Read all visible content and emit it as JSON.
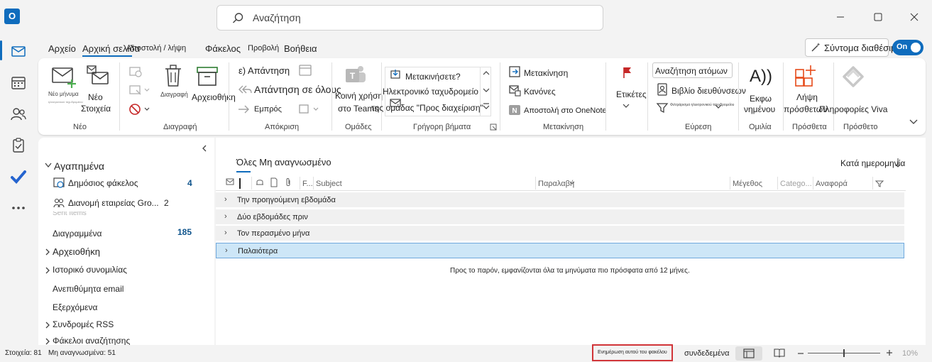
{
  "titlebar": {
    "app_icon_text": "O",
    "search_placeholder": "Αναζήτηση"
  },
  "tabs": [
    {
      "label": "Αρχείο"
    },
    {
      "label": "Αρχική σελίδα"
    },
    {
      "label": "Αποστολή / λήψη"
    },
    {
      "label": "Φάκελος"
    },
    {
      "label": "Προβολή"
    },
    {
      "label": "Βοήθεια"
    }
  ],
  "simplified_ribbon_label": "Σύντομα διαθέσιμο",
  "toggle_label": "On",
  "ribbon": {
    "new_email_label": "Νέο μήνυμα",
    "new_email_sub": "ηλεκτρονικού ταχυδρομείου",
    "new_items_line1": "Νέο",
    "new_items_line2": "Στοιχεία",
    "group_new": "Νέο",
    "delete_label": "Διαγραφή",
    "archive_label": "Αρχειοθήκη",
    "group_delete": "Διαγραφή",
    "reply_label": "ε) Απάντηση",
    "reply_all_label": "Απάντηση σε όλους",
    "forward_label": "Εμπρός",
    "group_respond": "Απόκριση",
    "teams_line1": "Κοινή χρήση",
    "teams_line2": "στο Teams",
    "group_teams": "Ομάδες",
    "quick_steps": [
      "Μετακινήσετε?",
      "Ηλεκτρονικό ταχυδρομείο",
      "της ομάδας \"Προς διαχείριση\""
    ],
    "group_quick_steps": "Γρήγορη βήματα",
    "move_label": "Μετακίνηση",
    "rules_label": "Κανόνες",
    "onenote_label": "Αποστολή στο OneNote",
    "group_move": "Μετακίνηση",
    "tags_label": "Ετικέτες",
    "find_people_placeholder": "Αναζήτηση ατόμων",
    "address_book_label": "Βιβλίο διευθύνσεων",
    "filter_email_label": "Φιλτράρισμα ηλεκτρονικού ταχυδρομείου",
    "group_find": "Εύρεση",
    "speak_glyph": "A))",
    "speak_line1": "Εκφω",
    "speak_line2": "νημένου",
    "group_speech": "Ομιλία",
    "addins_line1": "Λήψη",
    "addins_line2": "πρόσθετων",
    "group_addins": "Πρόσθετα",
    "viva_label": "Πληροφορίες Viva",
    "group_addin2": "Πρόσθετο"
  },
  "folder_pane": {
    "favorites_label": "Αγαπημένα",
    "items": [
      {
        "label": "Δημόσιος φάκελος",
        "count": "4"
      },
      {
        "label": "Διανομή εταιρείας Gro...",
        "count": "2"
      },
      {
        "label": "Sent Items",
        "count": ""
      },
      {
        "label": "Διαγραμμένα",
        "count": "185"
      },
      {
        "label": "Αρχειοθήκη",
        "count": ""
      },
      {
        "label": "Ιστορικό συνομιλίας",
        "count": ""
      },
      {
        "label": "Ανεπιθύμητα email",
        "count": ""
      },
      {
        "label": "Εξερχόμενα",
        "count": ""
      },
      {
        "label": "Συνδρομές RSS",
        "count": ""
      },
      {
        "label": "Φάκελοι αναζήτησης",
        "count": ""
      }
    ]
  },
  "message_list": {
    "filter_tabs": "Όλες Μη αναγνωσμένο",
    "sort_label": "Κατά ημερομηνία",
    "columns": {
      "flag_short": "F...",
      "subject": "Subject",
      "received": "Παραλαβή",
      "size": "Μέγεθος",
      "categories": "Catego...",
      "mention": "Αναφορά"
    },
    "groups": [
      {
        "label": "Την προηγούμενη εβδομάδα",
        "selected": false
      },
      {
        "label": "Δύο εβδομάδες πριν",
        "selected": false
      },
      {
        "label": "Τον περασμένο μήνα",
        "selected": false
      },
      {
        "label": "Παλαιότερα",
        "selected": true
      }
    ],
    "notice": "Προς το παρόν, εμφανίζονται όλα τα μηνύματα πιο πρόσφατα από 12 μήνες."
  },
  "statusbar": {
    "items_label": "Στοιχεία: 81",
    "unread_label": "Μη αναγνωσμένα: 51",
    "update_folder_label": "Ενημέρωση αυτού του φακέλου",
    "connected_label": "συνδεδεμένα",
    "zoom_label": "10%",
    "zoom_fraction": 0.5
  },
  "colors": {
    "accent": "#0f6cbd",
    "highlight_border": "#d13438"
  }
}
